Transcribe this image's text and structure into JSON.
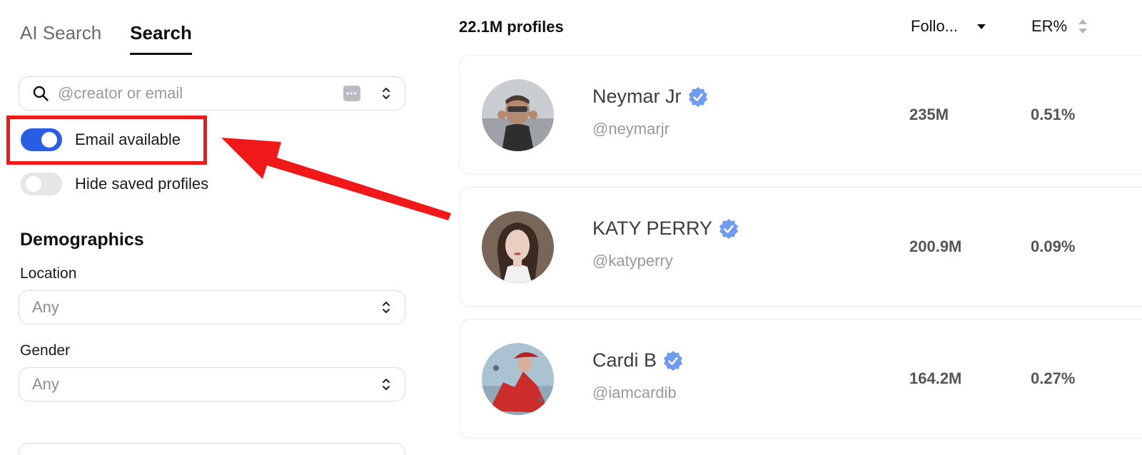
{
  "tabs": [
    {
      "label": "AI Search",
      "active": false
    },
    {
      "label": "Search",
      "active": true
    }
  ],
  "search": {
    "placeholder": "@creator or email",
    "icon": "search-icon",
    "keyboard_icon": "keyboard-icon"
  },
  "toggles": {
    "email_available": {
      "label": "Email available",
      "on": true
    },
    "hide_saved": {
      "label": "Hide saved profiles",
      "on": false
    }
  },
  "demographics": {
    "title": "Demographics",
    "location": {
      "label": "Location",
      "value": "Any"
    },
    "gender": {
      "label": "Gender",
      "value": "Any"
    }
  },
  "results": {
    "count": "22.1M profiles",
    "sort_followers": "Follo...",
    "sort_er": "ER%",
    "profiles": [
      {
        "name": "Neymar Jr",
        "handle": "@neymarjr",
        "followers": "235M",
        "er": "0.51%",
        "verified": true
      },
      {
        "name": "KATY PERRY",
        "handle": "@katyperry",
        "followers": "200.9M",
        "er": "0.09%",
        "verified": true
      },
      {
        "name": "Cardi B",
        "handle": "@iamcardib",
        "followers": "164.2M",
        "er": "0.27%",
        "verified": true
      }
    ]
  },
  "colors": {
    "accent": "#2a5de6",
    "highlight": "#f01818",
    "verified": "#6f9cf0"
  }
}
